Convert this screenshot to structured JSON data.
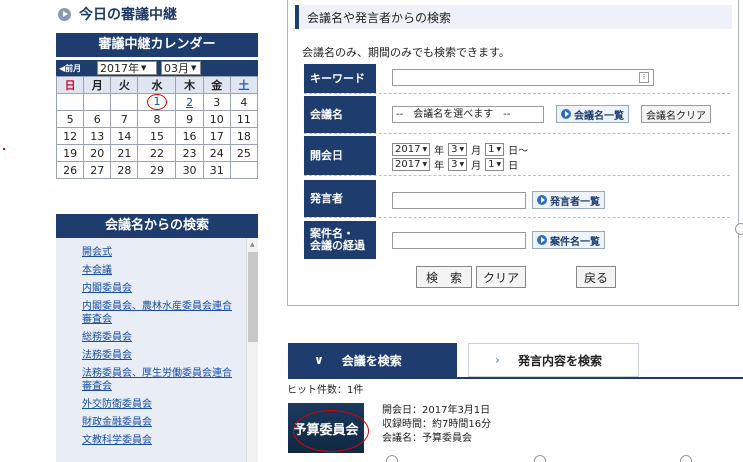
{
  "today": {
    "label": "今日の審議中継"
  },
  "calendar": {
    "title": "審議中継カレンダー",
    "prev": "◀前月",
    "year": "2017年",
    "month": "03月",
    "weekdays": [
      "日",
      "月",
      "火",
      "水",
      "木",
      "金",
      "土"
    ],
    "weeks": [
      [
        "",
        "",
        "",
        "1",
        "2",
        "3",
        "4"
      ],
      [
        "5",
        "6",
        "7",
        "8",
        "9",
        "10",
        "11"
      ],
      [
        "12",
        "13",
        "14",
        "15",
        "16",
        "17",
        "18"
      ],
      [
        "19",
        "20",
        "21",
        "22",
        "23",
        "24",
        "25"
      ],
      [
        "26",
        "27",
        "28",
        "29",
        "30",
        "31",
        ""
      ]
    ],
    "linked_days": [
      "1",
      "2"
    ],
    "circled_day": "1"
  },
  "meeting_search": {
    "title": "会議名からの検索",
    "items": [
      "開会式",
      "本会議",
      "内閣委員会",
      "内閣委員会、農林水産委員会連合審査会",
      "総務委員会",
      "法務委員会",
      "法務委員会、厚生労働委員会連合審査会",
      "外交防衛委員会",
      "財政金融委員会",
      "文教科学委員会"
    ]
  },
  "panel": {
    "title": "会議名や発言者からの検索",
    "note": "会議名のみ、期間のみでも検索できます。",
    "keyword_label": "キーワード",
    "keyword_value": "",
    "meeting_label": "会議名",
    "meeting_select": "--　会議名を選べます　--",
    "meeting_list_btn": "会議名一覧",
    "meeting_clear_btn": "会議名クリア",
    "date_label": "開会日",
    "from": {
      "year": "2017",
      "month": "3",
      "day": "1"
    },
    "to": {
      "year": "2017",
      "month": "3",
      "day": "1"
    },
    "year_unit": "年",
    "month_unit": "月",
    "day_from_unit": "日〜",
    "day_to_unit": "日",
    "speaker_label": "発言者",
    "speaker_btn": "発言者一覧",
    "agenda_label_1": "案件名・",
    "agenda_label_2": "会議の経過",
    "agenda_btn": "案件名一覧",
    "search_btn": "検　索",
    "clear_btn": "クリア",
    "back_btn": "戻る"
  },
  "tabs": {
    "meeting": "会議を検索",
    "speech": "発言内容を検索"
  },
  "result": {
    "hits": "ヒット件数：1件",
    "thumb": "予算委員会",
    "date": "開会日：2017年3月1日",
    "duration": "収録時間：約7時間16分",
    "name": "会議名：予算委員会"
  }
}
